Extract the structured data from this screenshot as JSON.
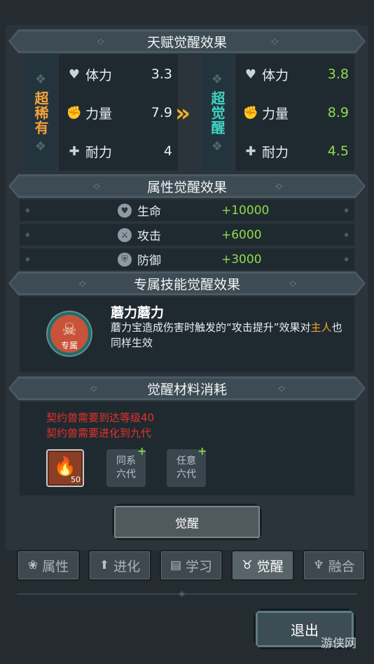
{
  "talent_section": {
    "title": "天赋觉醒效果",
    "before": {
      "rarity": "超稀有",
      "rarity_color": "#f3a23c",
      "stats": [
        {
          "icon": "heart-icon",
          "label": "体力",
          "value": "3.3"
        },
        {
          "icon": "fist-icon",
          "label": "力量",
          "value": "7.9"
        },
        {
          "icon": "shield-cross-icon",
          "label": "耐力",
          "value": "4"
        }
      ]
    },
    "after": {
      "rarity": "超觉醒",
      "rarity_color": "#3fd3c3",
      "stats": [
        {
          "icon": "heart-icon",
          "label": "体力",
          "value": "3.8"
        },
        {
          "icon": "fist-icon",
          "label": "力量",
          "value": "8.9"
        },
        {
          "icon": "shield-cross-icon",
          "label": "耐力",
          "value": "4.5"
        }
      ]
    },
    "arrow": "»"
  },
  "attribute_section": {
    "title": "属性觉醒效果",
    "rows": [
      {
        "icon": "shield-heart-icon",
        "label": "生命",
        "value": "+10000"
      },
      {
        "icon": "sword-icon",
        "label": "攻击",
        "value": "+6000"
      },
      {
        "icon": "shield-icon",
        "label": "防御",
        "value": "+3000"
      }
    ]
  },
  "skill_section": {
    "title": "专属技能觉醒效果",
    "icon_tag": "专属",
    "skill_name": "蘑力蘑力",
    "desc_part1": "蘑力宝造成伤害时触发的“攻击提升”效果对",
    "desc_highlight": "主人",
    "desc_part2": "也同样生效"
  },
  "material_section": {
    "title": "觉醒材料消耗",
    "requirements": [
      "契约兽需要到达等级40",
      "契约兽需要进化到九代"
    ],
    "main_item_level": "50",
    "slots": [
      {
        "line1": "同系",
        "line2": "六代"
      },
      {
        "line1": "任意",
        "line2": "六代"
      }
    ]
  },
  "awaken_button": "觉醒",
  "tabs": [
    {
      "icon": "paw-icon",
      "label": "属性",
      "active": false
    },
    {
      "icon": "up-arrow-icon",
      "label": "进化",
      "active": false
    },
    {
      "icon": "book-icon",
      "label": "学习",
      "active": false
    },
    {
      "icon": "beast-head-icon",
      "label": "觉醒",
      "active": true
    },
    {
      "icon": "fusion-icon",
      "label": "融合",
      "active": false
    }
  ],
  "exit_button": "退出",
  "watermark": "游侠网",
  "colors": {
    "positive": "#8fdc4a",
    "warning": "#e8302b",
    "highlight": "#f2a52a"
  }
}
